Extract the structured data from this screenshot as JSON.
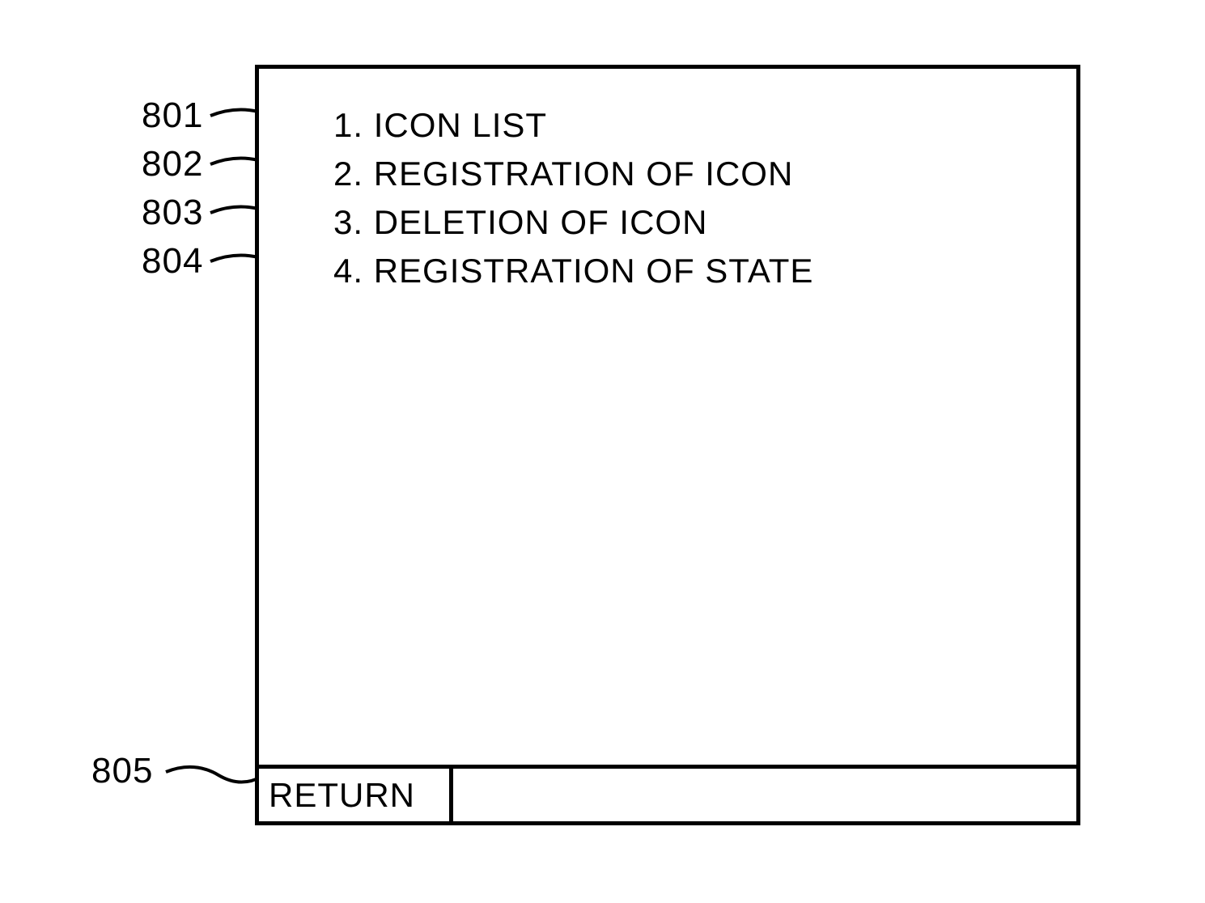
{
  "callouts": {
    "label_801": "801",
    "label_802": "802",
    "label_803": "803",
    "label_804": "804",
    "label_805": "805"
  },
  "menu": {
    "items": [
      {
        "num": "1.",
        "text": "ICON LIST"
      },
      {
        "num": "2.",
        "text": "REGISTRATION OF ICON"
      },
      {
        "num": "3.",
        "text": "DELETION OF ICON"
      },
      {
        "num": "4.",
        "text": "REGISTRATION OF STATE"
      }
    ]
  },
  "buttons": {
    "return_label": "RETURN"
  }
}
